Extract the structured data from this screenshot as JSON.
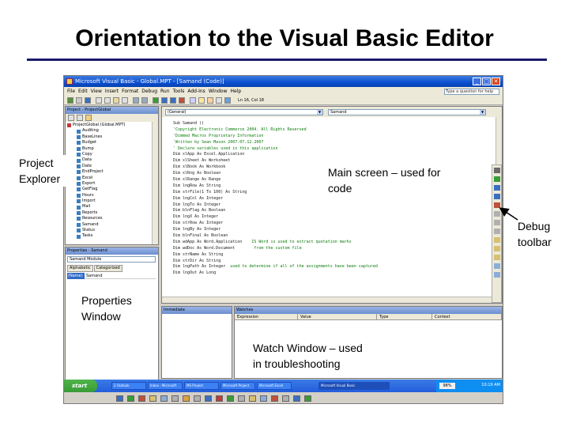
{
  "slide": {
    "title": "Orientation to the Visual Basic Editor"
  },
  "window": {
    "title": "Microsoft Visual Basic - Global.MPT - [Samand (Code)]",
    "controls": [
      "_",
      "□",
      "✕"
    ]
  },
  "menu": {
    "items": [
      "File",
      "Edit",
      "View",
      "Insert",
      "Format",
      "Debug",
      "Run",
      "Tools",
      "Add-Ins",
      "Window",
      "Help"
    ],
    "ask_placeholder": "Type a question for help"
  },
  "toolbar": {
    "status": "Ln 16, Col 18"
  },
  "project": {
    "title": "Project - ProjectGlobal",
    "tree": [
      "ProjectGlobal (Global.MPT)",
      "Auditing",
      "BaseLines",
      "Budget",
      "Bump",
      "Copy",
      "Data",
      "Date",
      "EndProject",
      "Excel",
      "Export",
      "GetFlag",
      "Hours",
      "Import",
      "Mail",
      "Reports",
      "Resources",
      "Samand",
      "Status",
      "Tasks"
    ]
  },
  "properties": {
    "title": "Properties - Samand",
    "combo": "Samand Module",
    "tabs": [
      "Alphabetic",
      "Categorized"
    ],
    "row_key": "(Name)",
    "row_value": "Samand"
  },
  "code": {
    "object_combo": "(General)",
    "proc_combo": "Samand",
    "lines": [
      "Sub Samand ()",
      "'Copyright Electronic Commerce 2004. All Rights Reserved",
      "'Dimmed Macros Proprietary Information",
      "'Written by Sean Mason 2007.07.12.2007",
      "' Declare variables used in this application",
      "Dim xlApp As Excel.Application",
      "Dim xlSheet As Worksheet",
      "Dim xlBook As Workbook",
      "Dim xlRng As Boolean",
      "Dim xlRange As Range",
      "Dim lngRow As String",
      "Dim strFile(1 To 100) As String",
      "Dim lngCol As Integer",
      "Dim lngTo As Integer",
      "Dim blnFlag As Boolean",
      "Dim lngX As Integer",
      "Dim strRow As Integer",
      "Dim lngBy As Integer",
      "Dim blnFinal As Boolean",
      "Dim wdApp As Word.Application",
      "Dim wdDoc As Word.Document",
      "Dim strName As String",
      "Dim strDir As String",
      "Dim lngPath As Integer",
      "Dim lngOut As Long"
    ],
    "note_a": "IS Word is used to extract quotation marks",
    "note_b": "from the custom file",
    "note_c": "used to determine if all of the assignments have been captured"
  },
  "immediate": {
    "title": "Immediate"
  },
  "watches": {
    "title": "Watches",
    "columns": [
      "Expression",
      "Value",
      "Type",
      "Context"
    ]
  },
  "taskbar": {
    "start": "start",
    "items": [
      "2 Outlook",
      "Inbox - Microsoft",
      "MS Project",
      "Microsoft Project",
      "Microsoft Excel",
      "Microsoft Visual Basic"
    ],
    "battery": "98%",
    "clock": "10:19 AM"
  },
  "callouts": {
    "project_explorer": [
      "Project",
      "Explorer"
    ],
    "main_screen": [
      "Main screen – used for",
      "code"
    ],
    "debug_toolbar": [
      "Debug",
      "toolbar"
    ],
    "properties_window": [
      "Properties",
      "Window"
    ],
    "watch_window": [
      "Watch Window – used",
      "in troubleshooting"
    ]
  }
}
